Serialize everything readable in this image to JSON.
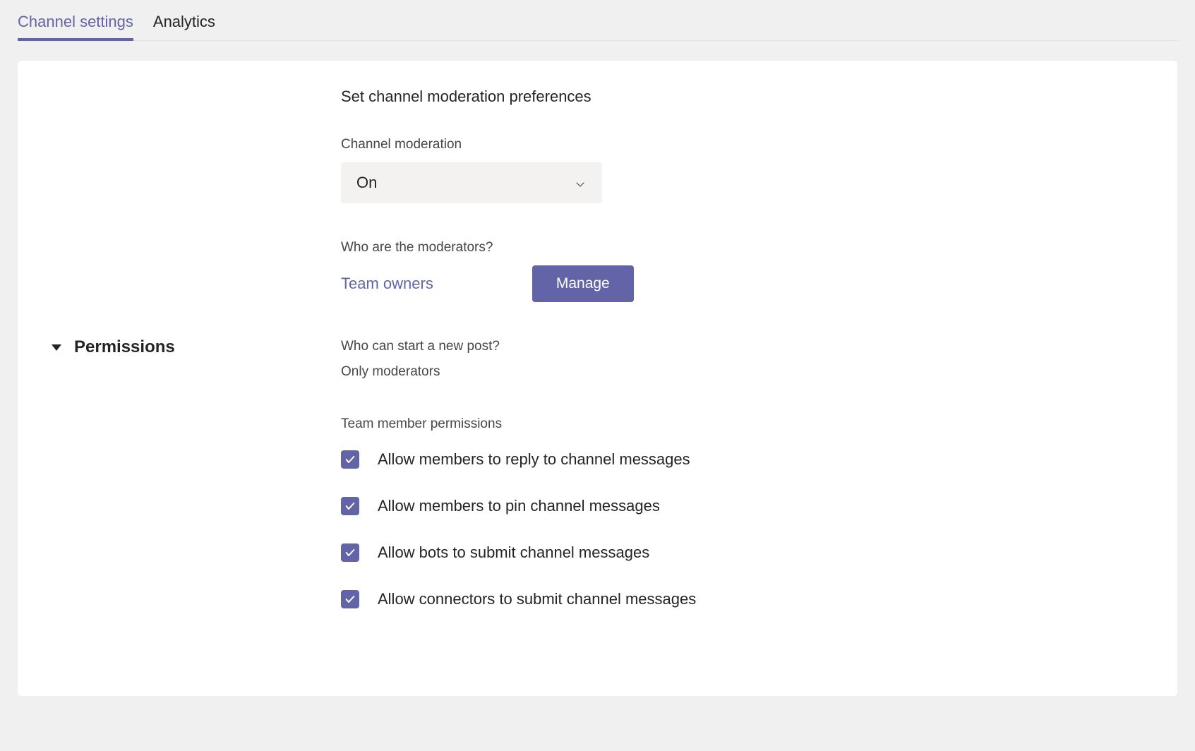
{
  "tabs": {
    "channel_settings": "Channel settings",
    "analytics": "Analytics"
  },
  "section": {
    "title": "Permissions",
    "lead": "Set channel moderation preferences"
  },
  "moderation": {
    "label": "Channel moderation",
    "value": "On"
  },
  "moderators": {
    "label": "Who are the moderators?",
    "value": "Team owners",
    "manage_button": "Manage"
  },
  "new_post": {
    "label": "Who can start a new post?",
    "value": "Only moderators"
  },
  "permissions": {
    "label": "Team member permissions",
    "items": [
      {
        "label": "Allow members to reply to channel messages",
        "checked": true
      },
      {
        "label": "Allow members to pin channel messages",
        "checked": true
      },
      {
        "label": "Allow bots to submit channel messages",
        "checked": true
      },
      {
        "label": "Allow connectors to submit channel messages",
        "checked": true
      }
    ]
  }
}
